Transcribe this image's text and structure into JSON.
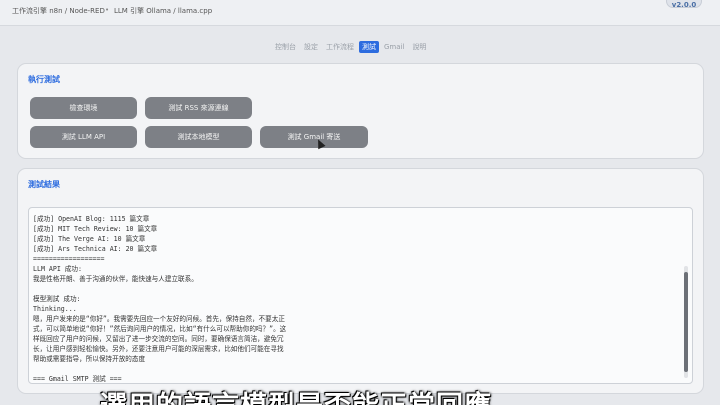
{
  "header": {
    "crumb_1": "工作流引擎 n8n / Node-RED",
    "crumb_2": "LLM 引擎 Ollama / llama.cpp",
    "separator": "•",
    "version": "v2.0.0"
  },
  "tabs": [
    {
      "label": "控制台"
    },
    {
      "label": "設定"
    },
    {
      "label": "工作流程"
    },
    {
      "label": "測試"
    },
    {
      "label": "Gmail"
    },
    {
      "label": "說明"
    }
  ],
  "test_panel": {
    "title": "執行測試",
    "buttons": {
      "check_env": "檢查環境",
      "test_rss": "測試 RSS 來源連線",
      "test_llm_api": "測試 LLM API",
      "test_local_model": "測試本地模型",
      "test_gmail": "測試 Gmail 寄送"
    }
  },
  "result_panel": {
    "title": "測試結果",
    "lines": [
      "[成功] OpenAI Blog: 1115 篇文章",
      "[成功] MIT Tech Review: 10 篇文章",
      "[成功] The Verge AI: 10 篇文章",
      "[成功] Ars Technica AI: 20 篇文章",
      "==================",
      "LLM API 成功:",
      "我是性格开朗、善于沟通的伙伴，能快速与人建立联系。",
      "",
      "模型測試 成功:",
      "Thinking...",
      "嗯，用户发来的是“你好”。我需要先回应一个友好的问候。首先，保持自然，不要太正",
      "式，可以简单地说“你好！”然后询问用户的情况，比如“有什么可以帮助你的吗？”。这",
      "样既回应了用户的问候，又留出了进一步交流的空间。同时，要确保语言简洁，避免冗",
      "长，让用户感到轻松愉快。另外，还要注意用户可能的深层需求，比如他们可能在寻找",
      "帮助或需要指导，所以保持开放的态度",
      "",
      "=== Gmail SMTP 測試 ==="
    ]
  },
  "subtitle": "選用的語言模型是否能正常回應"
}
